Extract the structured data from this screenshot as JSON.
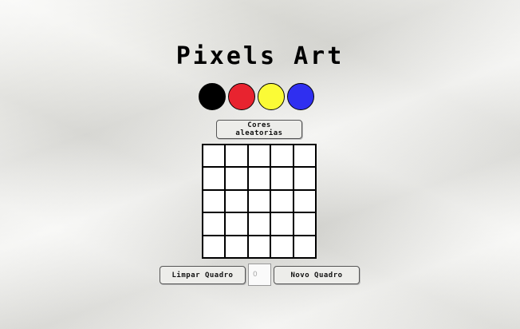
{
  "header": {
    "title": "Pixels Art"
  },
  "palette": [
    {
      "name": "black",
      "color": "#000000"
    },
    {
      "name": "red",
      "color": "#e8232f"
    },
    {
      "name": "yellow",
      "color": "#fbfb36"
    },
    {
      "name": "blue",
      "color": "#2f2ff0"
    }
  ],
  "controls": {
    "random_colors_label": "Cores\naleatorias",
    "clear_label": "Limpar Quadro",
    "board_size_placeholder": "0",
    "new_board_label": "Novo Quadro"
  },
  "board": {
    "rows": 5,
    "cols": 5,
    "pixel_color": "#ffffff"
  }
}
